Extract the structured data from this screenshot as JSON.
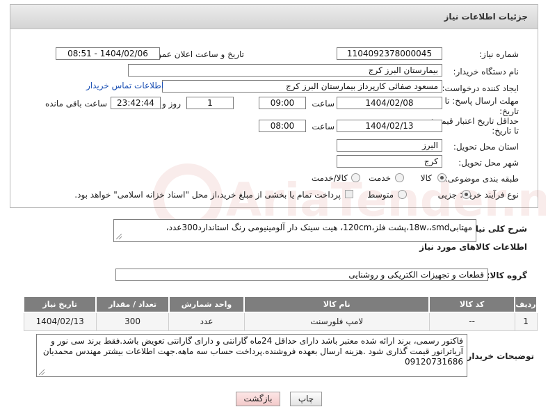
{
  "header": {
    "title": "جزئیات اطلاعات نیاز"
  },
  "form": {
    "need_number_label": "شماره نیاز:",
    "need_number": "1104092378000045",
    "announce_label": "تاریخ و ساعت اعلان عمومی:",
    "announce_value": "1404/02/06 - 08:51",
    "buyer_org_label": "نام دستگاه خریدار:",
    "buyer_org": "بیمارستان البرز کرج",
    "requester_label": "ایجاد کننده درخواست:",
    "requester": "مسعود صفائی کارپرداز بیمارستان البرز کرج",
    "contact_link": "اطلاعات تماس خریدار",
    "reply_deadline_label_1": "مهلت ارسال پاسخ: تا",
    "reply_deadline_label_2": "تاریخ:",
    "reply_date": "1404/02/08",
    "time_label": "ساعت",
    "reply_time": "09:00",
    "days_value": "1",
    "days_label": "روز و",
    "remaining_value": "23:42:44",
    "remaining_label": "ساعت باقی مانده",
    "validity_label_1": "حداقل تاریخ اعتبار قیمت:",
    "validity_label_2": "تا تاریخ:",
    "validity_date": "1404/02/13",
    "validity_time": "08:00",
    "province_label": "استان محل تحویل:",
    "province": "البرز",
    "city_label": "شهر محل تحویل:",
    "city": "کرج",
    "category_label": "طبقه بندی موضوعی:",
    "category_options": [
      "کالا",
      "خدمت",
      "کالا/خدمت"
    ],
    "process_label": "نوع فرآیند خرید :",
    "process_options": [
      "جزیی",
      "متوسط"
    ],
    "payment_note": "پرداخت تمام یا بخشی از مبلغ خرید،از محل \"اسناد خزانه اسلامی\" خواهد بود."
  },
  "description": {
    "label": "شرح کلی نیاز:",
    "text": "مهتابی18w،،smd،پشت فلز،120cm، هیت سینک دار آلومینیومی رنگ استاندارد300عدد،"
  },
  "goods": {
    "section_title": "اطلاعات کالاهای مورد نیاز",
    "group_label": "گروه کالا:",
    "group_value": "قطعات و تجهیزات الکتریکی و روشنایی",
    "columns": [
      "ردیف",
      "کد کالا",
      "نام کالا",
      "واحد شمارش",
      "تعداد / مقدار",
      "تاریخ نیاز"
    ],
    "rows": [
      [
        "1",
        "--",
        "لامپ فلورسنت",
        "عدد",
        "300",
        "1404/02/13"
      ]
    ]
  },
  "buyer_notes": {
    "label": "توضیحات خریدار:",
    "text": "فاکتور رسمی، برند ارائه شده معتبر باشد دارای حداقل 24ماه گارانتی و دارای گارانتی تعویض باشد.فقط برند سی نور و آریاترانور قیمت گذاری شود .هزینه ارسال بعهده فروشنده.پرداخت حساب سه ماهه.جهت اطلاعات بیشتر مهندس محمدیان 09120731686"
  },
  "buttons": {
    "print": "چاپ",
    "back": "بازگشت"
  },
  "watermark": {
    "text": "AriaTender.neT"
  },
  "colors": {
    "link": "#1a4fb4",
    "table_header": "#7e7e7e",
    "back_button_bg": "#f9d6d6",
    "watermark": "#c0392b"
  }
}
